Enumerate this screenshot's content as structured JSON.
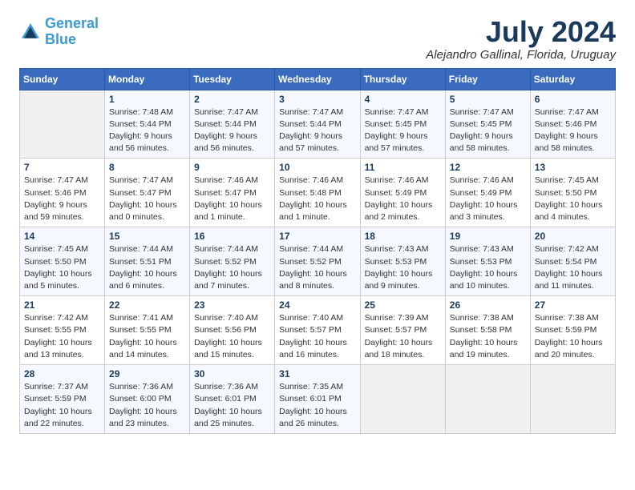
{
  "logo": {
    "line1": "General",
    "line2": "Blue"
  },
  "title": "July 2024",
  "subtitle": "Alejandro Gallinal, Florida, Uruguay",
  "weekdays": [
    "Sunday",
    "Monday",
    "Tuesday",
    "Wednesday",
    "Thursday",
    "Friday",
    "Saturday"
  ],
  "weeks": [
    [
      {
        "day": "",
        "info": ""
      },
      {
        "day": "1",
        "info": "Sunrise: 7:48 AM\nSunset: 5:44 PM\nDaylight: 9 hours\nand 56 minutes."
      },
      {
        "day": "2",
        "info": "Sunrise: 7:47 AM\nSunset: 5:44 PM\nDaylight: 9 hours\nand 56 minutes."
      },
      {
        "day": "3",
        "info": "Sunrise: 7:47 AM\nSunset: 5:44 PM\nDaylight: 9 hours\nand 57 minutes."
      },
      {
        "day": "4",
        "info": "Sunrise: 7:47 AM\nSunset: 5:45 PM\nDaylight: 9 hours\nand 57 minutes."
      },
      {
        "day": "5",
        "info": "Sunrise: 7:47 AM\nSunset: 5:45 PM\nDaylight: 9 hours\nand 58 minutes."
      },
      {
        "day": "6",
        "info": "Sunrise: 7:47 AM\nSunset: 5:46 PM\nDaylight: 9 hours\nand 58 minutes."
      }
    ],
    [
      {
        "day": "7",
        "info": "Sunrise: 7:47 AM\nSunset: 5:46 PM\nDaylight: 9 hours\nand 59 minutes."
      },
      {
        "day": "8",
        "info": "Sunrise: 7:47 AM\nSunset: 5:47 PM\nDaylight: 10 hours\nand 0 minutes."
      },
      {
        "day": "9",
        "info": "Sunrise: 7:46 AM\nSunset: 5:47 PM\nDaylight: 10 hours\nand 1 minute."
      },
      {
        "day": "10",
        "info": "Sunrise: 7:46 AM\nSunset: 5:48 PM\nDaylight: 10 hours\nand 1 minute."
      },
      {
        "day": "11",
        "info": "Sunrise: 7:46 AM\nSunset: 5:49 PM\nDaylight: 10 hours\nand 2 minutes."
      },
      {
        "day": "12",
        "info": "Sunrise: 7:46 AM\nSunset: 5:49 PM\nDaylight: 10 hours\nand 3 minutes."
      },
      {
        "day": "13",
        "info": "Sunrise: 7:45 AM\nSunset: 5:50 PM\nDaylight: 10 hours\nand 4 minutes."
      }
    ],
    [
      {
        "day": "14",
        "info": "Sunrise: 7:45 AM\nSunset: 5:50 PM\nDaylight: 10 hours\nand 5 minutes."
      },
      {
        "day": "15",
        "info": "Sunrise: 7:44 AM\nSunset: 5:51 PM\nDaylight: 10 hours\nand 6 minutes."
      },
      {
        "day": "16",
        "info": "Sunrise: 7:44 AM\nSunset: 5:52 PM\nDaylight: 10 hours\nand 7 minutes."
      },
      {
        "day": "17",
        "info": "Sunrise: 7:44 AM\nSunset: 5:52 PM\nDaylight: 10 hours\nand 8 minutes."
      },
      {
        "day": "18",
        "info": "Sunrise: 7:43 AM\nSunset: 5:53 PM\nDaylight: 10 hours\nand 9 minutes."
      },
      {
        "day": "19",
        "info": "Sunrise: 7:43 AM\nSunset: 5:53 PM\nDaylight: 10 hours\nand 10 minutes."
      },
      {
        "day": "20",
        "info": "Sunrise: 7:42 AM\nSunset: 5:54 PM\nDaylight: 10 hours\nand 11 minutes."
      }
    ],
    [
      {
        "day": "21",
        "info": "Sunrise: 7:42 AM\nSunset: 5:55 PM\nDaylight: 10 hours\nand 13 minutes."
      },
      {
        "day": "22",
        "info": "Sunrise: 7:41 AM\nSunset: 5:55 PM\nDaylight: 10 hours\nand 14 minutes."
      },
      {
        "day": "23",
        "info": "Sunrise: 7:40 AM\nSunset: 5:56 PM\nDaylight: 10 hours\nand 15 minutes."
      },
      {
        "day": "24",
        "info": "Sunrise: 7:40 AM\nSunset: 5:57 PM\nDaylight: 10 hours\nand 16 minutes."
      },
      {
        "day": "25",
        "info": "Sunrise: 7:39 AM\nSunset: 5:57 PM\nDaylight: 10 hours\nand 18 minutes."
      },
      {
        "day": "26",
        "info": "Sunrise: 7:38 AM\nSunset: 5:58 PM\nDaylight: 10 hours\nand 19 minutes."
      },
      {
        "day": "27",
        "info": "Sunrise: 7:38 AM\nSunset: 5:59 PM\nDaylight: 10 hours\nand 20 minutes."
      }
    ],
    [
      {
        "day": "28",
        "info": "Sunrise: 7:37 AM\nSunset: 5:59 PM\nDaylight: 10 hours\nand 22 minutes."
      },
      {
        "day": "29",
        "info": "Sunrise: 7:36 AM\nSunset: 6:00 PM\nDaylight: 10 hours\nand 23 minutes."
      },
      {
        "day": "30",
        "info": "Sunrise: 7:36 AM\nSunset: 6:01 PM\nDaylight: 10 hours\nand 25 minutes."
      },
      {
        "day": "31",
        "info": "Sunrise: 7:35 AM\nSunset: 6:01 PM\nDaylight: 10 hours\nand 26 minutes."
      },
      {
        "day": "",
        "info": ""
      },
      {
        "day": "",
        "info": ""
      },
      {
        "day": "",
        "info": ""
      }
    ]
  ]
}
